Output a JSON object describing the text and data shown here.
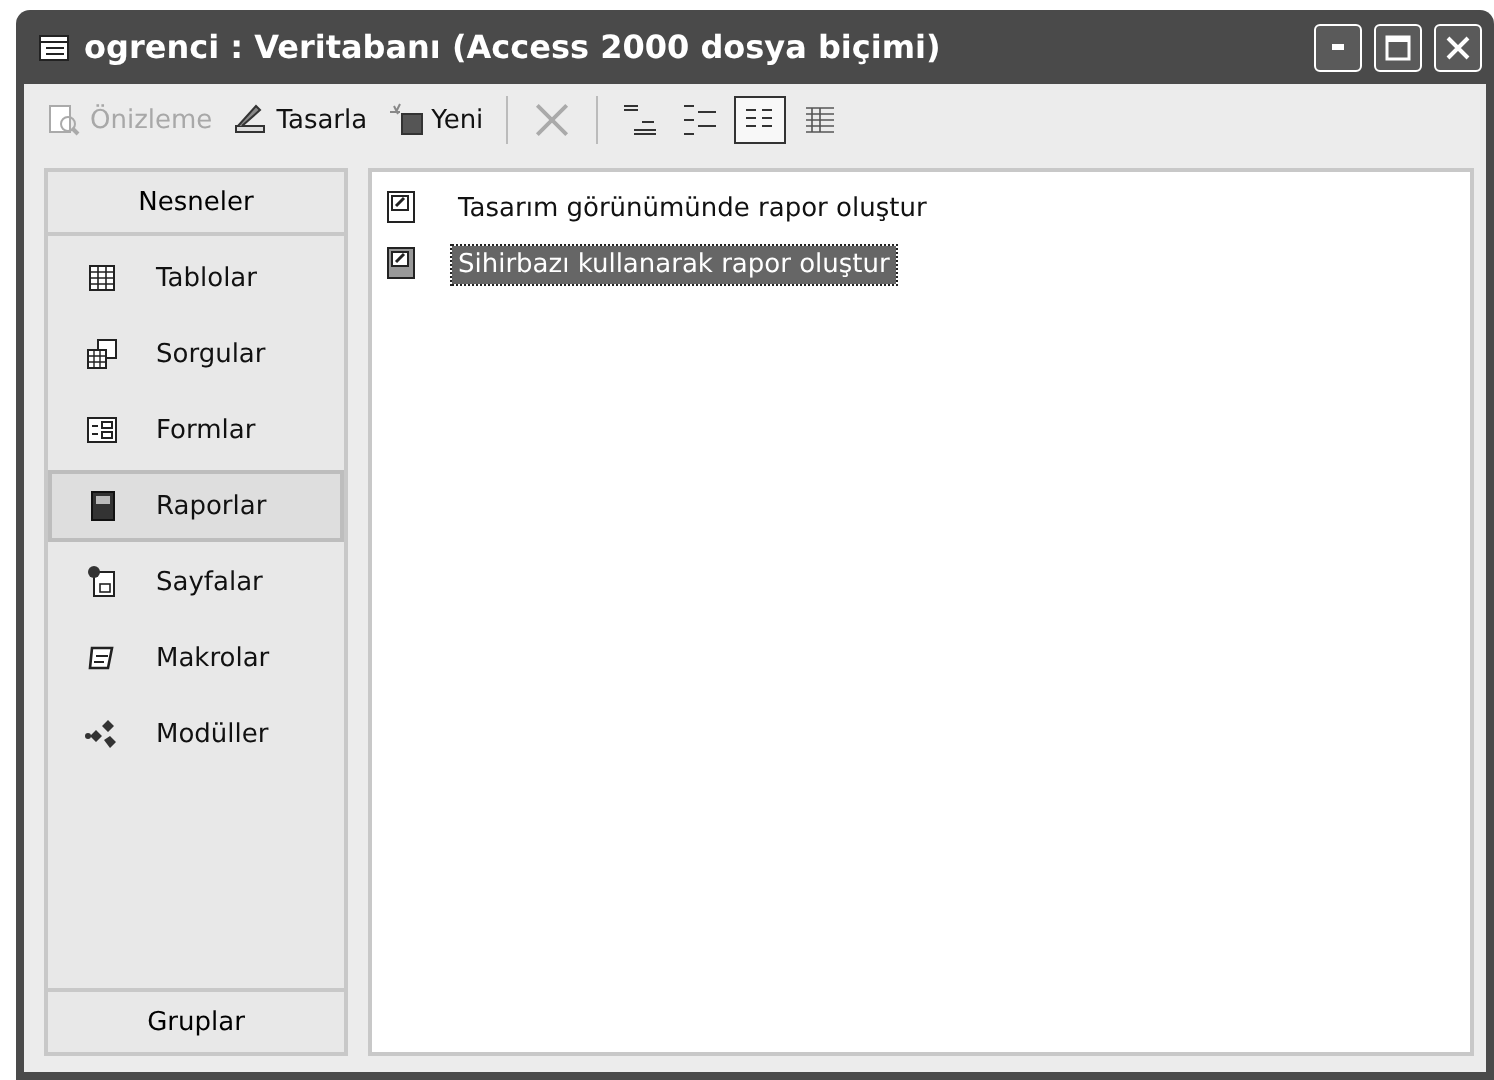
{
  "window": {
    "title": "ogrenci : Veritabanı (Access 2000 dosya biçimi)"
  },
  "toolbar": {
    "buttons": [
      {
        "kind": "preview",
        "label": "Önizleme",
        "disabled": true
      },
      {
        "kind": "design",
        "label": "Tasarla",
        "disabled": false
      },
      {
        "kind": "new",
        "label": "Yeni",
        "disabled": false
      },
      {
        "kind": "delete",
        "disabled": true
      }
    ],
    "views": [
      {
        "kind": "large",
        "selected": false
      },
      {
        "kind": "small",
        "selected": false
      },
      {
        "kind": "list",
        "selected": true
      },
      {
        "kind": "details",
        "selected": false
      }
    ]
  },
  "sidebar": {
    "header": "Nesneler",
    "items": [
      {
        "kind": "tables",
        "label": "Tablolar",
        "selected": false
      },
      {
        "kind": "queries",
        "label": "Sorgular",
        "selected": false
      },
      {
        "kind": "forms",
        "label": "Formlar",
        "selected": false
      },
      {
        "kind": "reports",
        "label": "Raporlar",
        "selected": true
      },
      {
        "kind": "pages",
        "label": "Sayfalar",
        "selected": false
      },
      {
        "kind": "macros",
        "label": "Makrolar",
        "selected": false
      },
      {
        "kind": "modules",
        "label": "Modüller",
        "selected": false
      }
    ],
    "footer": "Gruplar"
  },
  "list": {
    "items": [
      {
        "label": "Tasarım görünümünde rapor oluştur",
        "selected": false
      },
      {
        "label": "Sihirbazı kullanarak rapor oluştur",
        "selected": true
      }
    ]
  }
}
